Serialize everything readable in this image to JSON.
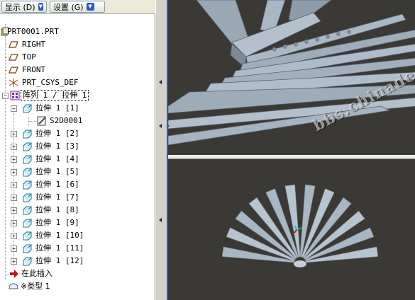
{
  "toolbar": {
    "show_label": "显示 (D)",
    "settings_label": "设置 (G)"
  },
  "tree": {
    "items": [
      {
        "label": "PRT0001.PRT",
        "icon": "part-icon"
      },
      {
        "label": "RIGHT",
        "icon": "datum-plane-icon"
      },
      {
        "label": "TOP",
        "icon": "datum-plane-icon"
      },
      {
        "label": "FRONT",
        "icon": "datum-plane-icon"
      },
      {
        "label": "PRT_CSYS_DEF",
        "icon": "csys-icon"
      },
      {
        "label": "阵列 1 / 拉伸 1",
        "icon": "pattern-icon"
      },
      {
        "label": "拉伸 1 [1]",
        "icon": "extrude-icon"
      },
      {
        "label": "S2D0001",
        "icon": "sketch-icon"
      },
      {
        "label": "拉伸 1 [2]",
        "icon": "extrude-icon"
      },
      {
        "label": "拉伸 1 [3]",
        "icon": "extrude-icon"
      },
      {
        "label": "拉伸 1 [4]",
        "icon": "extrude-icon"
      },
      {
        "label": "拉伸 1 [5]",
        "icon": "extrude-icon"
      },
      {
        "label": "拉伸 1 [6]",
        "icon": "extrude-icon"
      },
      {
        "label": "拉伸 1 [7]",
        "icon": "extrude-icon"
      },
      {
        "label": "拉伸 1 [8]",
        "icon": "extrude-icon"
      },
      {
        "label": "拉伸 1 [9]",
        "icon": "extrude-icon"
      },
      {
        "label": "拉伸 1 [10]",
        "icon": "extrude-icon"
      },
      {
        "label": "拉伸 1 [11]",
        "icon": "extrude-icon"
      },
      {
        "label": "拉伸 1 [12]",
        "icon": "extrude-icon"
      },
      {
        "label": "在此插入",
        "icon": "insert-here-arrow-icon"
      },
      {
        "label": "※类型 1",
        "icon": "type-feature-icon"
      }
    ]
  },
  "watermark": "bbs.chinade.net",
  "colors": {
    "viewport_bg": "#3b3935",
    "model_color": "#a9b6c4",
    "insert_arrow": "#c0161a",
    "selection_border": "#3c5b9a"
  }
}
